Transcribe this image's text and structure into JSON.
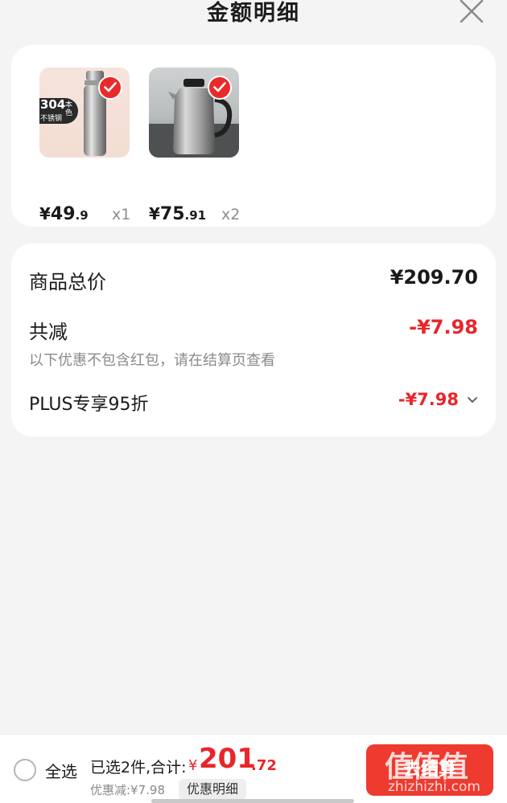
{
  "header": {
    "title": "金额明细",
    "close_icon": "close-icon"
  },
  "products": [
    {
      "image_badge": {
        "line1": "304",
        "line2": "不锈钢",
        "side": "本色"
      },
      "checked": true,
      "price_symbol": "¥",
      "price_int": "49",
      "price_dec": ".9",
      "quantity": "x1"
    },
    {
      "checked": true,
      "price_symbol": "¥",
      "price_int": "75",
      "price_dec": ".91",
      "quantity": "x2"
    }
  ],
  "summary": {
    "total_label": "商品总价",
    "total_value": "¥209.70",
    "reduce_label": "共减",
    "reduce_value": "-¥7.98",
    "note": "以下优惠不包含红包，请在结算页查看",
    "plus_label": "PLUS专享95折",
    "plus_value": "-¥7.98"
  },
  "bottom_bar": {
    "select_all": "全选",
    "selected_info": "已选2件,合计:",
    "total_symbol": "¥",
    "total_int": "201",
    "total_dec": ".72",
    "discount_info": "优惠减:¥7.98",
    "detail_button": "优惠明细",
    "checkout_button": "去结算"
  },
  "watermark": {
    "logo": "值值值",
    "text": "zhizhizhi.com"
  },
  "colors": {
    "accent_red": "#e8262a",
    "checkout_bg": "#ee3a2f",
    "page_bg": "#f4f4f4"
  }
}
